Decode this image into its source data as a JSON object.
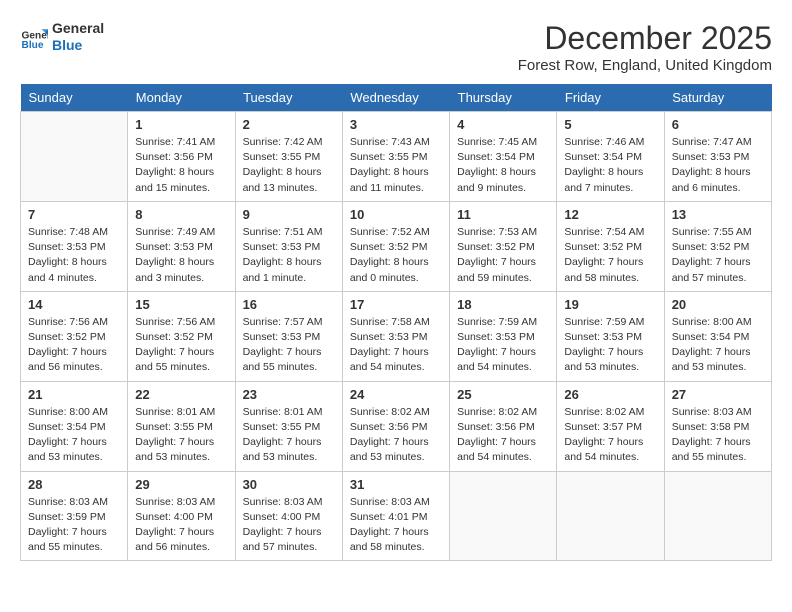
{
  "logo": {
    "line1": "General",
    "line2": "Blue"
  },
  "title": "December 2025",
  "location": "Forest Row, England, United Kingdom",
  "days_of_week": [
    "Sunday",
    "Monday",
    "Tuesday",
    "Wednesday",
    "Thursday",
    "Friday",
    "Saturday"
  ],
  "weeks": [
    [
      {
        "day": "",
        "content": ""
      },
      {
        "day": "1",
        "content": "Sunrise: 7:41 AM\nSunset: 3:56 PM\nDaylight: 8 hours\nand 15 minutes."
      },
      {
        "day": "2",
        "content": "Sunrise: 7:42 AM\nSunset: 3:55 PM\nDaylight: 8 hours\nand 13 minutes."
      },
      {
        "day": "3",
        "content": "Sunrise: 7:43 AM\nSunset: 3:55 PM\nDaylight: 8 hours\nand 11 minutes."
      },
      {
        "day": "4",
        "content": "Sunrise: 7:45 AM\nSunset: 3:54 PM\nDaylight: 8 hours\nand 9 minutes."
      },
      {
        "day": "5",
        "content": "Sunrise: 7:46 AM\nSunset: 3:54 PM\nDaylight: 8 hours\nand 7 minutes."
      },
      {
        "day": "6",
        "content": "Sunrise: 7:47 AM\nSunset: 3:53 PM\nDaylight: 8 hours\nand 6 minutes."
      }
    ],
    [
      {
        "day": "7",
        "content": "Sunrise: 7:48 AM\nSunset: 3:53 PM\nDaylight: 8 hours\nand 4 minutes."
      },
      {
        "day": "8",
        "content": "Sunrise: 7:49 AM\nSunset: 3:53 PM\nDaylight: 8 hours\nand 3 minutes."
      },
      {
        "day": "9",
        "content": "Sunrise: 7:51 AM\nSunset: 3:53 PM\nDaylight: 8 hours\nand 1 minute."
      },
      {
        "day": "10",
        "content": "Sunrise: 7:52 AM\nSunset: 3:52 PM\nDaylight: 8 hours\nand 0 minutes."
      },
      {
        "day": "11",
        "content": "Sunrise: 7:53 AM\nSunset: 3:52 PM\nDaylight: 7 hours\nand 59 minutes."
      },
      {
        "day": "12",
        "content": "Sunrise: 7:54 AM\nSunset: 3:52 PM\nDaylight: 7 hours\nand 58 minutes."
      },
      {
        "day": "13",
        "content": "Sunrise: 7:55 AM\nSunset: 3:52 PM\nDaylight: 7 hours\nand 57 minutes."
      }
    ],
    [
      {
        "day": "14",
        "content": "Sunrise: 7:56 AM\nSunset: 3:52 PM\nDaylight: 7 hours\nand 56 minutes."
      },
      {
        "day": "15",
        "content": "Sunrise: 7:56 AM\nSunset: 3:52 PM\nDaylight: 7 hours\nand 55 minutes."
      },
      {
        "day": "16",
        "content": "Sunrise: 7:57 AM\nSunset: 3:53 PM\nDaylight: 7 hours\nand 55 minutes."
      },
      {
        "day": "17",
        "content": "Sunrise: 7:58 AM\nSunset: 3:53 PM\nDaylight: 7 hours\nand 54 minutes."
      },
      {
        "day": "18",
        "content": "Sunrise: 7:59 AM\nSunset: 3:53 PM\nDaylight: 7 hours\nand 54 minutes."
      },
      {
        "day": "19",
        "content": "Sunrise: 7:59 AM\nSunset: 3:53 PM\nDaylight: 7 hours\nand 53 minutes."
      },
      {
        "day": "20",
        "content": "Sunrise: 8:00 AM\nSunset: 3:54 PM\nDaylight: 7 hours\nand 53 minutes."
      }
    ],
    [
      {
        "day": "21",
        "content": "Sunrise: 8:00 AM\nSunset: 3:54 PM\nDaylight: 7 hours\nand 53 minutes."
      },
      {
        "day": "22",
        "content": "Sunrise: 8:01 AM\nSunset: 3:55 PM\nDaylight: 7 hours\nand 53 minutes."
      },
      {
        "day": "23",
        "content": "Sunrise: 8:01 AM\nSunset: 3:55 PM\nDaylight: 7 hours\nand 53 minutes."
      },
      {
        "day": "24",
        "content": "Sunrise: 8:02 AM\nSunset: 3:56 PM\nDaylight: 7 hours\nand 53 minutes."
      },
      {
        "day": "25",
        "content": "Sunrise: 8:02 AM\nSunset: 3:56 PM\nDaylight: 7 hours\nand 54 minutes."
      },
      {
        "day": "26",
        "content": "Sunrise: 8:02 AM\nSunset: 3:57 PM\nDaylight: 7 hours\nand 54 minutes."
      },
      {
        "day": "27",
        "content": "Sunrise: 8:03 AM\nSunset: 3:58 PM\nDaylight: 7 hours\nand 55 minutes."
      }
    ],
    [
      {
        "day": "28",
        "content": "Sunrise: 8:03 AM\nSunset: 3:59 PM\nDaylight: 7 hours\nand 55 minutes."
      },
      {
        "day": "29",
        "content": "Sunrise: 8:03 AM\nSunset: 4:00 PM\nDaylight: 7 hours\nand 56 minutes."
      },
      {
        "day": "30",
        "content": "Sunrise: 8:03 AM\nSunset: 4:00 PM\nDaylight: 7 hours\nand 57 minutes."
      },
      {
        "day": "31",
        "content": "Sunrise: 8:03 AM\nSunset: 4:01 PM\nDaylight: 7 hours\nand 58 minutes."
      },
      {
        "day": "",
        "content": ""
      },
      {
        "day": "",
        "content": ""
      },
      {
        "day": "",
        "content": ""
      }
    ]
  ]
}
